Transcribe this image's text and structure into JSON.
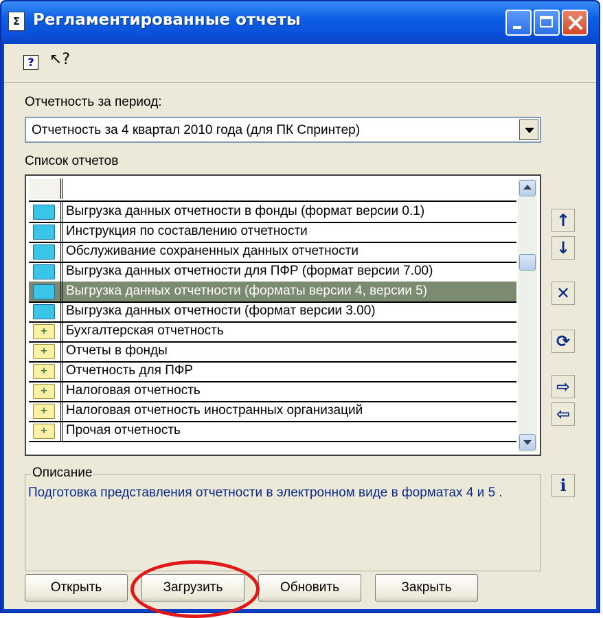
{
  "window": {
    "title": "Регламентированные отчеты"
  },
  "period": {
    "label": "Отчетность за период:",
    "value": "Отчетность за 4 квартал 2010 года (для ПК Спринтер)"
  },
  "reports": {
    "label": "Список отчетов",
    "rows": [
      {
        "icon": "folder-blue-icon",
        "label": "Выгрузка данных отчетности в фонды (формат версии 0.1)"
      },
      {
        "icon": "folder-blue-icon",
        "label": "Инструкция по составлению отчетности"
      },
      {
        "icon": "folder-blue-icon",
        "label": "Обслуживание сохраненных данных отчетности"
      },
      {
        "icon": "folder-blue-icon",
        "label": "Выгрузка данных отчетности для ПФР (формат версии 7.00)"
      },
      {
        "icon": "folder-blue-icon",
        "label": "Выгрузка данных отчетности (форматы версии 4, версии 5)",
        "selected": true
      },
      {
        "icon": "folder-blue-icon",
        "label": "Выгрузка данных отчетности (формат версии 3.00)"
      },
      {
        "icon": "folder-plus-icon",
        "label": "Бухгалтерская отчетность"
      },
      {
        "icon": "folder-plus-icon",
        "label": "Отчеты в фонды"
      },
      {
        "icon": "folder-plus-icon",
        "label": "Отчетность для ПФР"
      },
      {
        "icon": "folder-plus-icon",
        "label": "Налоговая отчетность"
      },
      {
        "icon": "folder-plus-icon",
        "label": "Налоговая отчетность иностранных организаций"
      },
      {
        "icon": "folder-plus-icon",
        "label": "Прочая отчетность"
      }
    ]
  },
  "description": {
    "title": "Описание",
    "text": "Подготовка представления отчетности в электронном виде в форматах 4 и 5 ."
  },
  "buttons": {
    "open": "Открыть",
    "load": "Загрузить",
    "refresh": "Обновить",
    "close": "Закрыть"
  },
  "colors": {
    "titlebar": "#0d5fe4",
    "selection": "#7c8b6f",
    "description_text": "#0a2a8a",
    "highlight_circle": "#e01818"
  }
}
